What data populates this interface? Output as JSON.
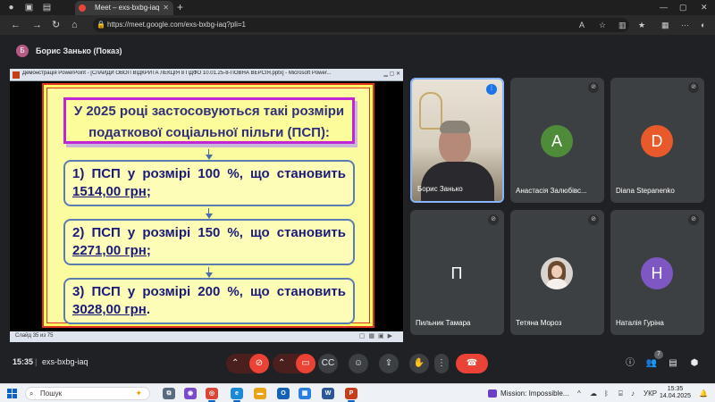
{
  "browser": {
    "tab_title": "Meet – exs-bxbg-iaq",
    "url": "https://meet.google.com/exs-bxbg-iaq?pli=1"
  },
  "meet": {
    "presenter_initial": "Б",
    "presenter_title": "Борис Занько (Показ)",
    "time": "15:35",
    "separator": "|",
    "meeting_code": "exs-bxbg-iaq",
    "participants_count": "7"
  },
  "presentation": {
    "window_title": "Демонстрація PowerPoint - [СЛАЙДИ ОВОП ВІДКРИТА ЛЕКЦІЯ 8  ПДФО 10.01.25-8-ПОВНА ВЕРСІЯ.pptx] - Microsoft Power...",
    "status": "Слайд 35 из 75",
    "slide": {
      "heading_line1": "У 2025 році застосовуються такі розміри",
      "heading_line2": "податкової соціальної пільги (ПСП):",
      "items": [
        {
          "text": "1) ПСП у розмірі 100 %, що становить",
          "amount": "1514,00 грн",
          "suffix": ";"
        },
        {
          "text": "2) ПСП у розмірі 150 %, що становить",
          "amount": "2271,00 грн",
          "suffix": ";"
        },
        {
          "text": "3) ПСП у розмірі 200 %, що становить",
          "amount": "3028,00 грн",
          "suffix": "."
        }
      ]
    }
  },
  "participants": [
    {
      "name": "Борис Занько",
      "initial": "",
      "color": "",
      "video": true,
      "speaking": true
    },
    {
      "name": "Анастасія Залюбівс...",
      "initial": "А",
      "color": "#4e8c3a",
      "video": false
    },
    {
      "name": "Diana Stepanenko",
      "initial": "D",
      "color": "#e8592b",
      "video": false
    },
    {
      "name": "Пильник Тамара",
      "initial": "П",
      "color": "#3c4043",
      "video": false
    },
    {
      "name": "Тетяна Мороз",
      "initial": "",
      "color": "#3c4043",
      "video": false,
      "photo": true
    },
    {
      "name": "Наталія Гуріна",
      "initial": "Н",
      "color": "#7e57c2",
      "video": false
    }
  ],
  "taskbar": {
    "search_placeholder": "Пошук",
    "media_title": "Mission: Impossible...",
    "language": "УКР",
    "clock_time": "15:35",
    "clock_date": "14.04.2025"
  },
  "colors": {
    "accent": "#8ab4f8",
    "end_call": "#ea4335",
    "slide_bg": "#fbfba0",
    "slide_border": "#e03020"
  }
}
